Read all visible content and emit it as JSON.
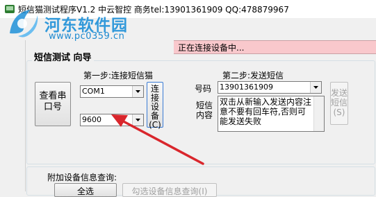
{
  "window": {
    "title": "短信猫测试程序V1.2     中云智控 商务tel:13901361909    QQ:478879967"
  },
  "watermark": {
    "name": "河东软件园",
    "url": "www.pc0359.cn"
  },
  "status": {
    "text": "正在连接设备中..."
  },
  "sms_test": {
    "group_title": "短信测试 向导",
    "view_port_button": "查看串口号",
    "step1_label": "第一步:连接短信猫",
    "port_value": "COM1",
    "baud_value": "9600",
    "connect_button": "连接设备(C)",
    "step2_label": "第二步:发送短信",
    "number_label": "号码",
    "number_value": "13901361909",
    "content_label": "短信内容",
    "content_value": "双击从新输入发送内容注意不要有回车符,否则可能发送失败",
    "send_button": "发送短信(S)"
  },
  "device_info": {
    "group_title": "附加设备信息查询:",
    "select_all_button": "全选",
    "query_button": "勾选设备信息查询(I)"
  },
  "colors": {
    "status_bg": "#f9c8cc",
    "annotation_arrow": "#d9262c",
    "watermark": "#1e90d8"
  }
}
